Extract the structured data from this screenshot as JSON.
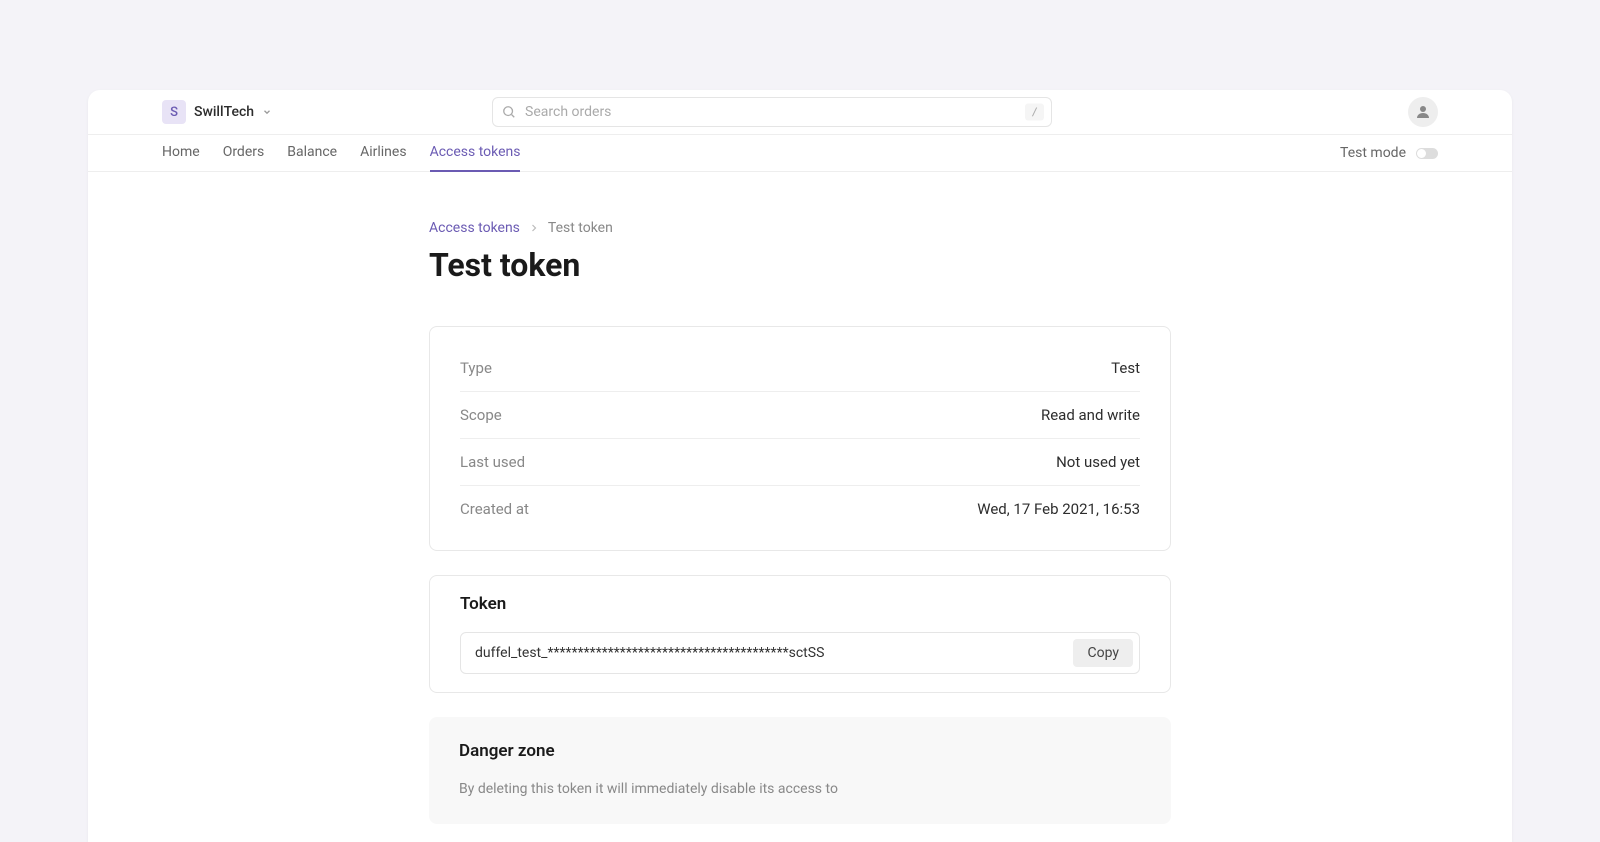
{
  "header": {
    "org_badge_letter": "S",
    "org_name": "SwillTech",
    "search_placeholder": "Search orders",
    "search_shortcut": "/"
  },
  "nav": {
    "items": [
      "Home",
      "Orders",
      "Balance",
      "Airlines",
      "Access tokens"
    ],
    "active_index": 4,
    "test_mode_label": "Test mode"
  },
  "breadcrumb": {
    "parent": "Access tokens",
    "current": "Test token"
  },
  "page": {
    "title": "Test token"
  },
  "details": [
    {
      "label": "Type",
      "value": "Test"
    },
    {
      "label": "Scope",
      "value": "Read and write"
    },
    {
      "label": "Last used",
      "value": "Not used yet"
    },
    {
      "label": "Created at",
      "value": "Wed, 17 Feb 2021, 16:53"
    }
  ],
  "token": {
    "title": "Token",
    "value": "duffel_test_****************************************sctSS",
    "copy_label": "Copy"
  },
  "danger": {
    "title": "Danger zone",
    "text": "By deleting this token it will immediately disable its access to"
  }
}
